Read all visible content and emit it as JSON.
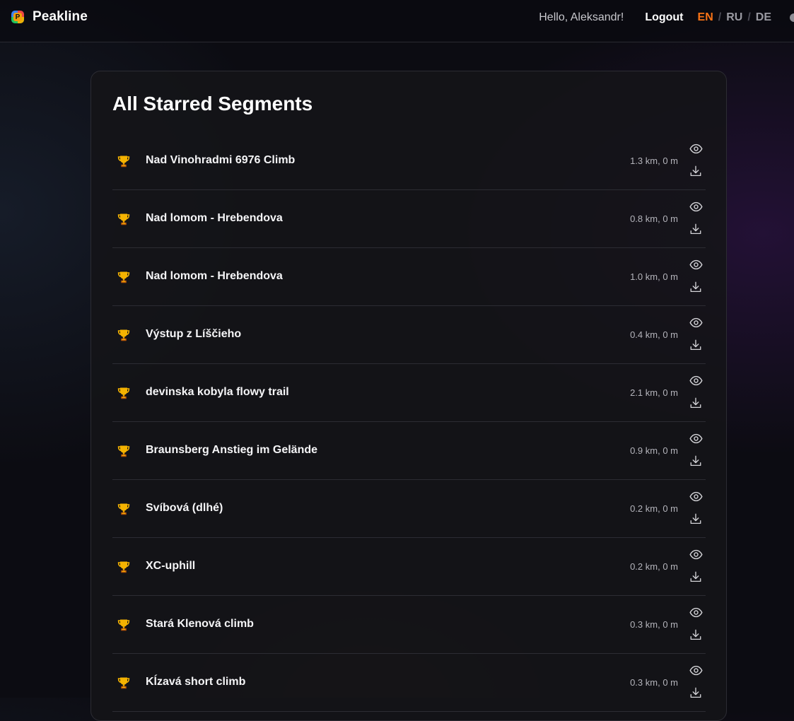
{
  "app": {
    "brand_mark": "P",
    "name": "Peakline"
  },
  "header": {
    "greeting": "Hello, Aleksandr!",
    "logout_label": "Logout",
    "languages": [
      {
        "code": "EN",
        "active": true
      },
      {
        "code": "RU",
        "active": false
      },
      {
        "code": "DE",
        "active": false
      }
    ],
    "separator": "/"
  },
  "page": {
    "title": "All Starred Segments"
  },
  "segments": [
    {
      "name": "Nad Vinohradmi 6976 Climb",
      "stats": "1.3 km, 0 m"
    },
    {
      "name": "Nad lomom - Hrebendova",
      "stats": "0.8 km, 0 m"
    },
    {
      "name": "Nad lomom - Hrebendova",
      "stats": "1.0 km, 0 m"
    },
    {
      "name": "Výstup z Líščieho",
      "stats": "0.4 km, 0 m"
    },
    {
      "name": "devinska kobyla flowy trail",
      "stats": "2.1 km, 0 m"
    },
    {
      "name": "Braunsberg Anstieg im Gelände",
      "stats": "0.9 km, 0 m"
    },
    {
      "name": "Svíbová (dlhé)",
      "stats": "0.2 km, 0 m"
    },
    {
      "name": "XC-uphill",
      "stats": "0.2 km, 0 m"
    },
    {
      "name": "Stará Klenová climb",
      "stats": "0.3 km, 0 m"
    },
    {
      "name": "Kĺzavá short climb",
      "stats": "0.3 km, 0 m"
    }
  ],
  "icons": {
    "row_icon": "trophy-icon",
    "view": "eye-icon",
    "download": "download-icon"
  },
  "colors": {
    "accent_active_lang": "#f97316",
    "trophy_gold": "#f5b301",
    "trophy_base": "#b45309"
  }
}
